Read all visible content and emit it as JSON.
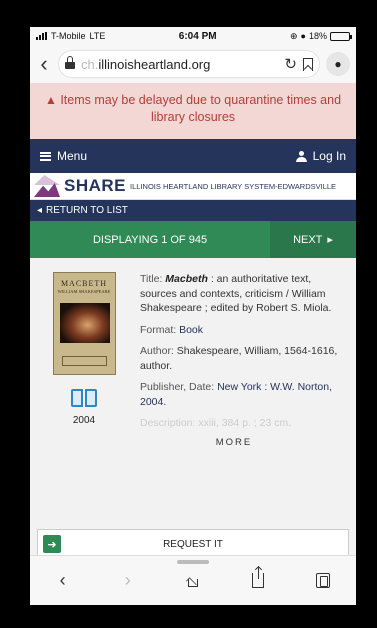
{
  "status": {
    "carrier": "T-Mobile",
    "network": "LTE",
    "time": "6:04 PM",
    "battery": "18%",
    "battery_level": 0.18
  },
  "browser": {
    "url_faded": "ch.",
    "url_main": "illinoisheartland.org"
  },
  "alert": {
    "text": "Items may be delayed due to quarantine times and library closures"
  },
  "nav": {
    "menu": "Menu",
    "login": "Log In"
  },
  "banner": {
    "title": "SHARE",
    "subtitle": "ILLINOIS HEARTLAND LIBRARY SYSTEM-EDWARDSVILLE"
  },
  "return_label": "RETURN TO LIST",
  "pager": {
    "displaying": "DISPLAYING 1 OF 945",
    "next": "NEXT"
  },
  "cover": {
    "title": "MACBETH",
    "author": "WILLIAM SHAKESPEARE"
  },
  "record": {
    "year": "2004",
    "title_label": "Title:",
    "title_main": "Macbeth",
    "title_rest": ": an authoritative text, sources and contexts, criticism / William Shakespeare ; edited by Robert S. Miola.",
    "format_label": "Format:",
    "format_value": "Book",
    "author_label": "Author:",
    "author_value": "Shakespeare, William, 1564-1616, author.",
    "publisher_label": "Publisher, Date:",
    "publisher_value": "New York : W.W. Norton, 2004.",
    "description": "Description: xxiii, 384 p. ; 23 cm.",
    "more": "MORE"
  },
  "request": {
    "label": "REQUEST IT"
  },
  "icons": {
    "alert": "warning-triangle-icon",
    "menu": "hamburger-icon",
    "login": "user-icon",
    "format": "open-book-icon"
  },
  "colors": {
    "navy": "#25345a",
    "green": "#2f8a55",
    "alert_bg": "#f2d7d5",
    "alert_text": "#b33e3a",
    "purple": "#7a3b7e"
  }
}
